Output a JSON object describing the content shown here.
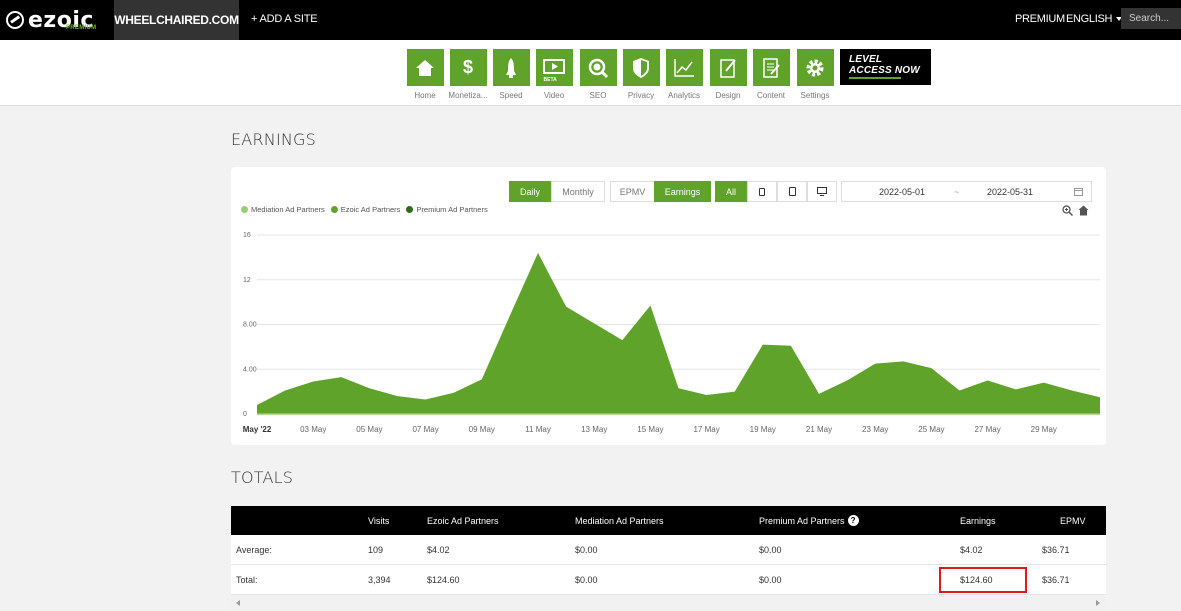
{
  "topbar": {
    "logo_text": "ezoic",
    "logo_badge": "PREMIUM",
    "site_name": "WHEELCHAIRED.COM",
    "add_site": "+ ADD A SITE",
    "premium": "PREMIUM",
    "language": "ENGLISH",
    "search_placeholder": "Search..."
  },
  "nav": {
    "items": [
      {
        "label": "Home",
        "icon": "home-icon"
      },
      {
        "label": "Monetiza...",
        "icon": "dollar-icon"
      },
      {
        "label": "Speed",
        "icon": "rocket-icon"
      },
      {
        "label": "Video",
        "icon": "video-icon",
        "badge": "BETA"
      },
      {
        "label": "SEO",
        "icon": "magnifier-icon"
      },
      {
        "label": "Privacy",
        "icon": "shield-icon"
      },
      {
        "label": "Analytics",
        "icon": "line-chart-icon"
      },
      {
        "label": "Design",
        "icon": "design-icon"
      },
      {
        "label": "Content",
        "icon": "document-icon"
      },
      {
        "label": "Settings",
        "icon": "gear-icon"
      }
    ],
    "level_line1": "LEVEL",
    "level_line2": "ACCESS NOW"
  },
  "earnings": {
    "title": "EARNINGS",
    "daily": "Daily",
    "monthly": "Monthly",
    "epmv": "EPMV",
    "earnings_btn": "Earnings",
    "all": "All",
    "date_start": "2022-05-01",
    "date_sep": "~",
    "date_end": "2022-05-31",
    "legend": [
      "Mediation Ad Partners",
      "Ezoic Ad Partners",
      "Premium Ad Partners"
    ]
  },
  "colors": {
    "accent": "#5fa32b",
    "legend_mediation": "#9ccc6e",
    "legend_ezoic": "#5fa32b",
    "legend_premium": "#2e6b1a",
    "highlight": "#e0191e"
  },
  "chart_data": {
    "type": "area",
    "y_tick_labels": [
      "0",
      "4.00",
      "8.00",
      "12",
      "16"
    ],
    "x_tick_labels": [
      "May '22",
      "03 May",
      "05 May",
      "07 May",
      "09 May",
      "11 May",
      "13 May",
      "15 May",
      "17 May",
      "19 May",
      "21 May",
      "23 May",
      "25 May",
      "27 May",
      "29 May"
    ],
    "ylim": [
      0,
      16
    ],
    "x": [
      1,
      2,
      3,
      4,
      5,
      6,
      7,
      8,
      9,
      10,
      11,
      12,
      13,
      14,
      15,
      16,
      17,
      18,
      19,
      20,
      21,
      22,
      23,
      24,
      25,
      26,
      27,
      28,
      29,
      30,
      31
    ],
    "series": [
      {
        "name": "Mediation Ad Partners",
        "values": [
          0,
          0,
          0,
          0,
          0,
          0,
          0,
          0,
          0,
          0,
          0,
          0,
          0,
          0,
          0,
          0,
          0,
          0,
          0,
          0,
          0,
          0,
          0,
          0,
          0,
          0,
          0,
          0,
          0,
          0,
          0
        ]
      },
      {
        "name": "Ezoic Ad Partners",
        "values": [
          0.8,
          2.1,
          2.9,
          3.3,
          2.3,
          1.6,
          1.3,
          1.9,
          3.1,
          8.8,
          14.4,
          9.6,
          8.1,
          6.6,
          9.7,
          2.3,
          1.7,
          2.0,
          6.2,
          6.1,
          1.8,
          3.0,
          4.5,
          4.7,
          4.1,
          2.1,
          3.0,
          2.2,
          2.8,
          2.1,
          1.5
        ]
      },
      {
        "name": "Premium Ad Partners",
        "values": [
          0,
          0,
          0,
          0,
          0,
          0,
          0,
          0,
          0,
          0,
          0,
          0,
          0,
          0,
          0,
          0,
          0,
          0,
          0,
          0,
          0,
          0,
          0,
          0,
          0,
          0,
          0,
          0,
          0,
          0,
          0
        ]
      }
    ],
    "grid": true,
    "legend": "top-left"
  },
  "totals": {
    "title": "TOTALS",
    "headers": [
      "",
      "Visits",
      "Ezoic Ad Partners",
      "Mediation Ad Partners",
      "Premium Ad Partners",
      "Earnings",
      "EPMV"
    ],
    "rows": [
      [
        "Average:",
        "109",
        "$4.02",
        "$0.00",
        "$0.00",
        "$4.02",
        "$36.71"
      ],
      [
        "Total:",
        "3,394",
        "$124.60",
        "$0.00",
        "$0.00",
        "$124.60",
        "$36.71"
      ]
    ]
  }
}
